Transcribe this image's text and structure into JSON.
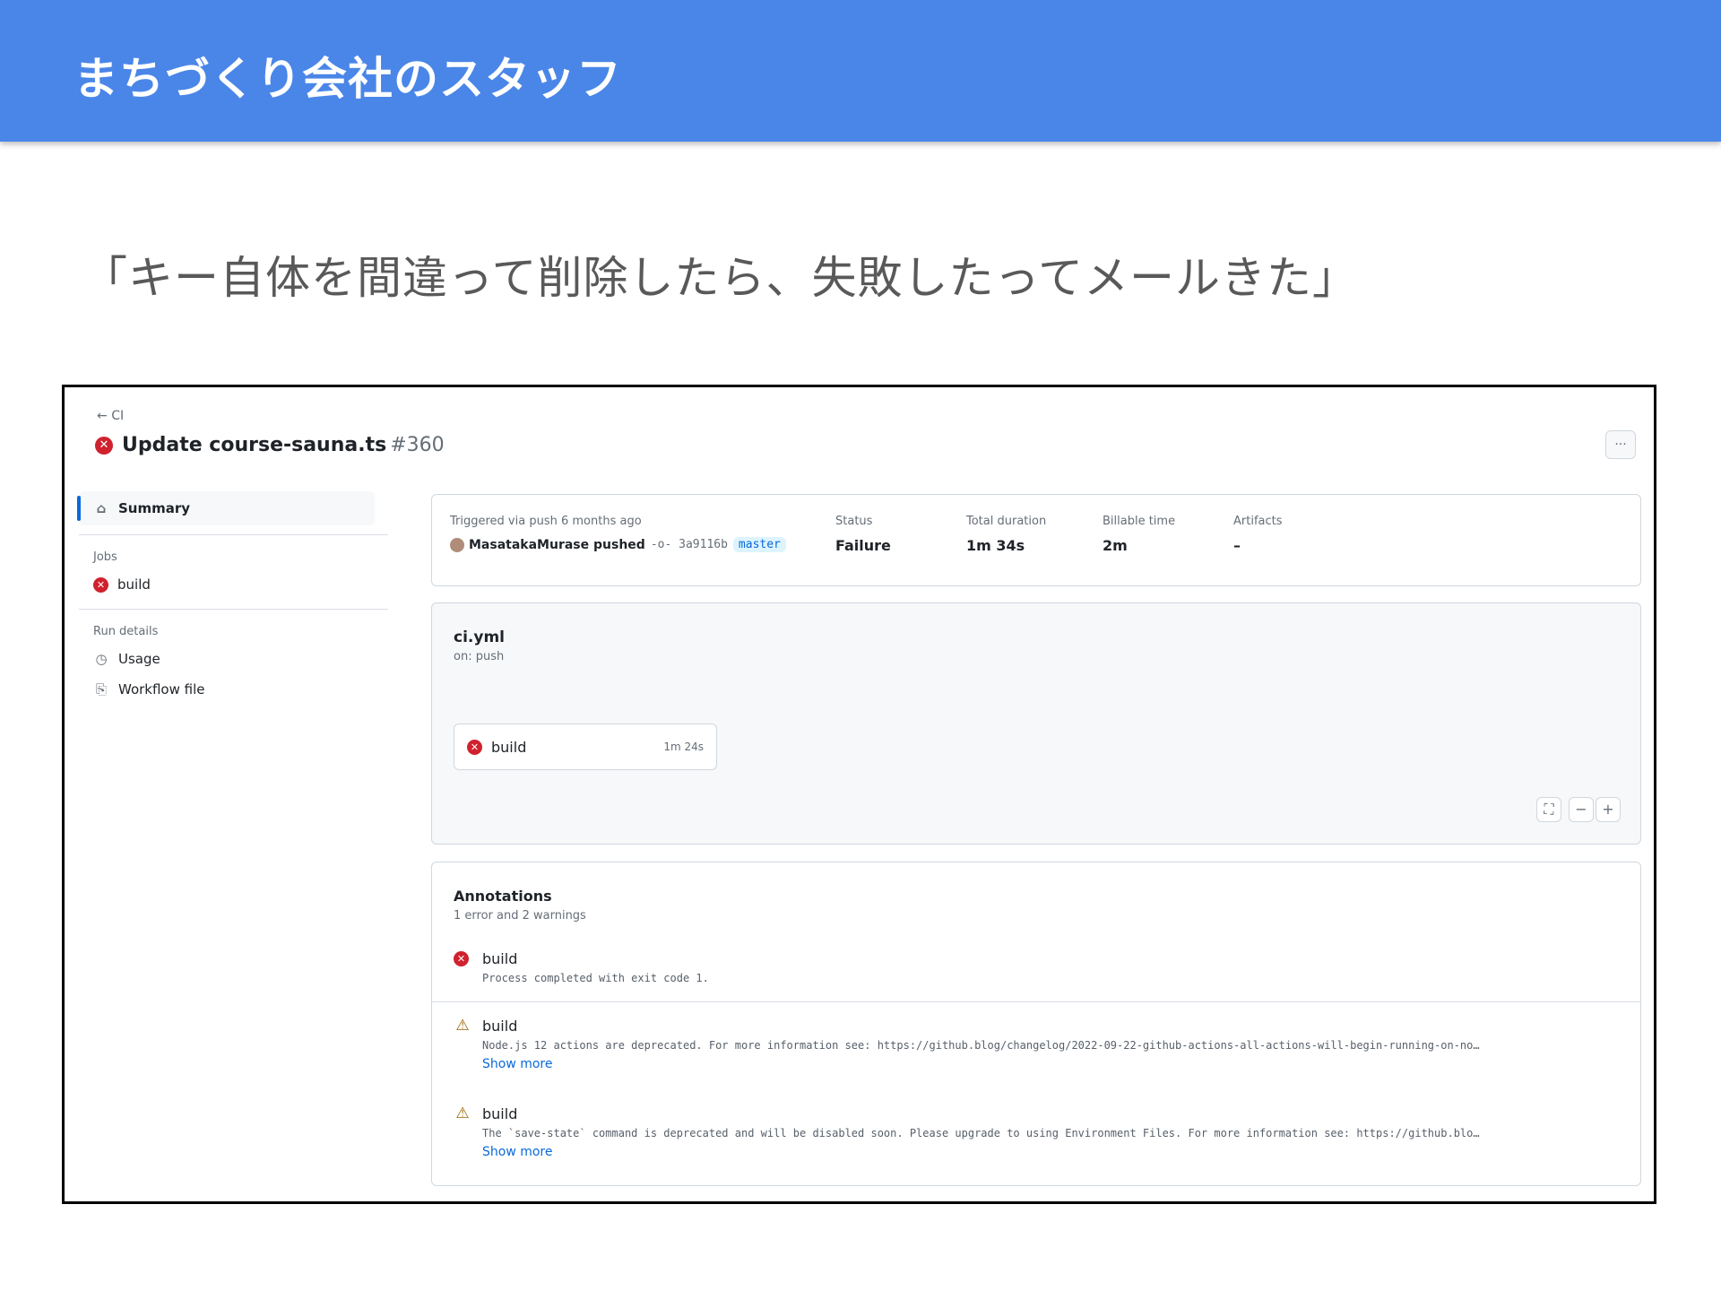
{
  "slide": {
    "title": "まちづくり会社のスタッフ",
    "quote": "「キー自体を間違って削除したら、失敗したってメールきた」"
  },
  "colors": {
    "header_bg": "#4a86e8",
    "error": "#cf222e",
    "link": "#0969da",
    "warning": "#9a6700"
  },
  "run": {
    "back_label": "CI",
    "title": "Update course-sauna.ts",
    "number": "#360",
    "more_label": "···"
  },
  "sidebar": {
    "summary_label": "Summary",
    "jobs_heading": "Jobs",
    "job_label": "build",
    "run_details_heading": "Run details",
    "usage_label": "Usage",
    "workflow_file_label": "Workflow file"
  },
  "summary": {
    "trigger_label": "Triggered via push 6 months ago",
    "actor": "MasatakaMurase pushed",
    "sha": "-o- 3a9116b",
    "branch": "master",
    "status_label": "Status",
    "status_value": "Failure",
    "duration_label": "Total duration",
    "duration_value": "1m 34s",
    "billable_label": "Billable time",
    "billable_value": "2m",
    "artifacts_label": "Artifacts",
    "artifacts_value": "–"
  },
  "workflow": {
    "file": "ci.yml",
    "trigger": "on: push",
    "job_name": "build",
    "job_duration": "1m 24s",
    "zoom_fit": "⛶",
    "zoom_out": "−",
    "zoom_in": "+"
  },
  "annotations": {
    "title": "Annotations",
    "subtitle": "1 error and 2 warnings",
    "items": [
      {
        "job": "build",
        "message": "Process completed with exit code 1."
      },
      {
        "job": "build",
        "message": "Node.js 12 actions are deprecated. For more information see: https://github.blog/changelog/2022-09-22-github-actions-all-actions-will-begin-running-on-no…",
        "link": "Show more"
      },
      {
        "job": "build",
        "message": "The `save-state` command is deprecated and will be disabled soon. Please upgrade to using Environment Files. For more information see: https://github.blo…",
        "link": "Show more"
      }
    ]
  }
}
